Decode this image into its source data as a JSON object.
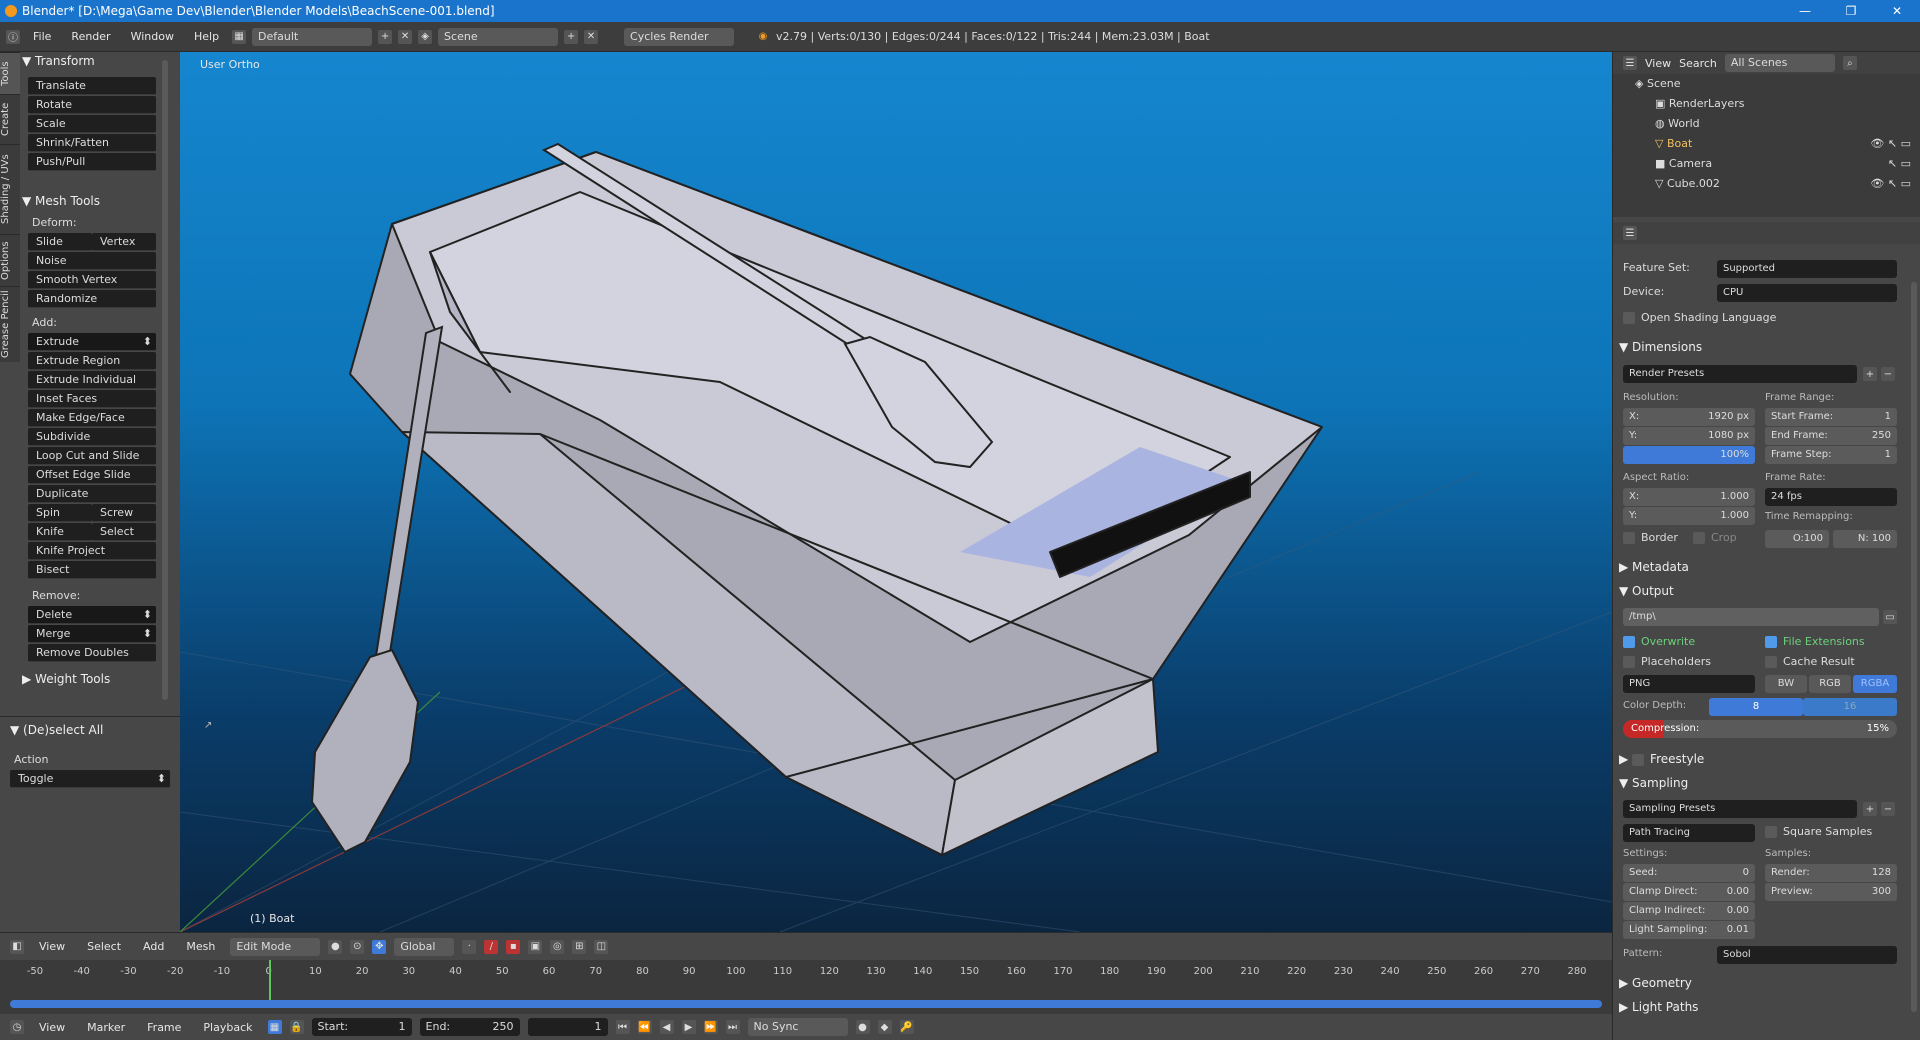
{
  "title": "Blender* [D:\\Mega\\Game Dev\\Blender\\Blender Models\\BeachScene-001.blend]",
  "menu": [
    "File",
    "Render",
    "Window",
    "Help"
  ],
  "screen_layout": "Default",
  "scene": "Scene",
  "engine": "Cycles Render",
  "stats": "v2.79 | Verts:0/130 | Edges:0/244 | Faces:0/122 | Tris:244 | Mem:23.03M | Boat",
  "tools": {
    "tabs": [
      "Tools",
      "Create",
      "Shading / UVs",
      "Options",
      "Grease Pencil"
    ],
    "transform_header": "Transform",
    "transform": [
      "Translate",
      "Rotate",
      "Scale",
      "Shrink/Fatten",
      "Push/Pull"
    ],
    "mesh_header": "Mesh Tools",
    "deform_label": "Deform:",
    "deform_pair": [
      "Slide Edge",
      "Vertex"
    ],
    "deform": [
      "Noise",
      "Smooth Vertex",
      "Randomize"
    ],
    "add_label": "Add:",
    "extrude": "Extrude",
    "add": [
      "Extrude Region",
      "Extrude Individual",
      "Inset Faces",
      "Make Edge/Face",
      "Subdivide",
      "Loop Cut and Slide",
      "Offset Edge Slide",
      "Duplicate"
    ],
    "spin_pair": [
      "Spin",
      "Screw"
    ],
    "knife_pair": [
      "Knife",
      "Select"
    ],
    "add2": [
      "Knife Project",
      "Bisect"
    ],
    "remove_label": "Remove:",
    "remove_sel": [
      "Delete",
      "Merge"
    ],
    "remove": [
      "Remove Doubles"
    ],
    "weight_header": "Weight Tools",
    "op_header": "(De)select All",
    "action_label": "Action",
    "action_value": "Toggle"
  },
  "viewport": {
    "view_label": "User Ortho",
    "object_label": "(1) Boat"
  },
  "outliner": {
    "menu": [
      "View",
      "Search"
    ],
    "filter": "All Scenes",
    "items": [
      "Scene",
      "RenderLayers",
      "World",
      "Boat",
      "Camera",
      "Cube.002"
    ]
  },
  "props": {
    "feature_set_label": "Feature Set:",
    "feature_set": "Supported",
    "device_label": "Device:",
    "device": "CPU",
    "osl": "Open Shading Language",
    "dimensions": "Dimensions",
    "render_presets": "Render Presets",
    "resolution_label": "Resolution:",
    "res_x_label": "X:",
    "res_x": "1920 px",
    "res_y_label": "Y:",
    "res_y": "1080 px",
    "res_pct": "100%",
    "frame_range_label": "Frame Range:",
    "start_label": "Start Frame:",
    "start": "1",
    "end_label": "End Frame:",
    "end": "250",
    "step_label": "Frame Step:",
    "step": "1",
    "aspect_label": "Aspect Ratio:",
    "asp_x": "1.000",
    "asp_y": "1.000",
    "frame_rate_label": "Frame Rate:",
    "fps": "24 fps",
    "time_remap_label": "Time Remapping:",
    "remap_old": "O:100",
    "remap_new": "N: 100",
    "border": "Border",
    "crop": "Crop",
    "metadata": "Metadata",
    "output": "Output",
    "path": "/tmp\\",
    "overwrite": "Overwrite",
    "file_ext": "File Extensions",
    "placeholders": "Placeholders",
    "cache": "Cache Result",
    "format": "PNG",
    "bw": "BW",
    "rgb": "RGB",
    "rgba": "RGBA",
    "color_depth_label": "Color Depth:",
    "depth8": "8",
    "depth16": "16",
    "compression_label": "Compression:",
    "compression": "15%",
    "compression_value": 0.15,
    "freestyle": "Freestyle",
    "sampling": "Sampling",
    "sampling_presets": "Sampling Presets",
    "integrator": "Path Tracing",
    "square_samples": "Square Samples",
    "settings_label": "Settings:",
    "samples_label": "Samples:",
    "seed_label": "Seed:",
    "seed": "0",
    "render_label": "Render:",
    "render_samples": "128",
    "preview_label": "Preview:",
    "preview_samples": "300",
    "clamp_direct": "Clamp Direct:",
    "clamp_direct_v": "0.00",
    "clamp_indirect": "Clamp Indirect:",
    "clamp_indirect_v": "0.00",
    "light_sampling": "Light Sampling:",
    "light_sampling_v": "0.01",
    "pattern_label": "Pattern:",
    "pattern": "Sobol",
    "geometry": "Geometry",
    "light_paths": "Light Paths"
  },
  "view_header": {
    "menu": [
      "View",
      "Select",
      "Add",
      "Mesh"
    ],
    "mode": "Edit Mode",
    "orientation": "Global"
  },
  "timeline": {
    "ticks": [
      "-50",
      "-40",
      "-30",
      "-20",
      "-10",
      "0",
      "10",
      "20",
      "30",
      "40",
      "50",
      "60",
      "70",
      "80",
      "90",
      "100",
      "110",
      "120",
      "130",
      "140",
      "150",
      "160",
      "170",
      "180",
      "190",
      "200",
      "210",
      "220",
      "230",
      "240",
      "250",
      "260",
      "270",
      "280"
    ],
    "current_frame": 0
  },
  "timeline_header": {
    "menu": [
      "View",
      "Marker",
      "Frame",
      "Playback"
    ],
    "start_label": "Start:",
    "start": "1",
    "end_label": "End:",
    "end": "250",
    "current": "1",
    "sync": "No Sync"
  }
}
